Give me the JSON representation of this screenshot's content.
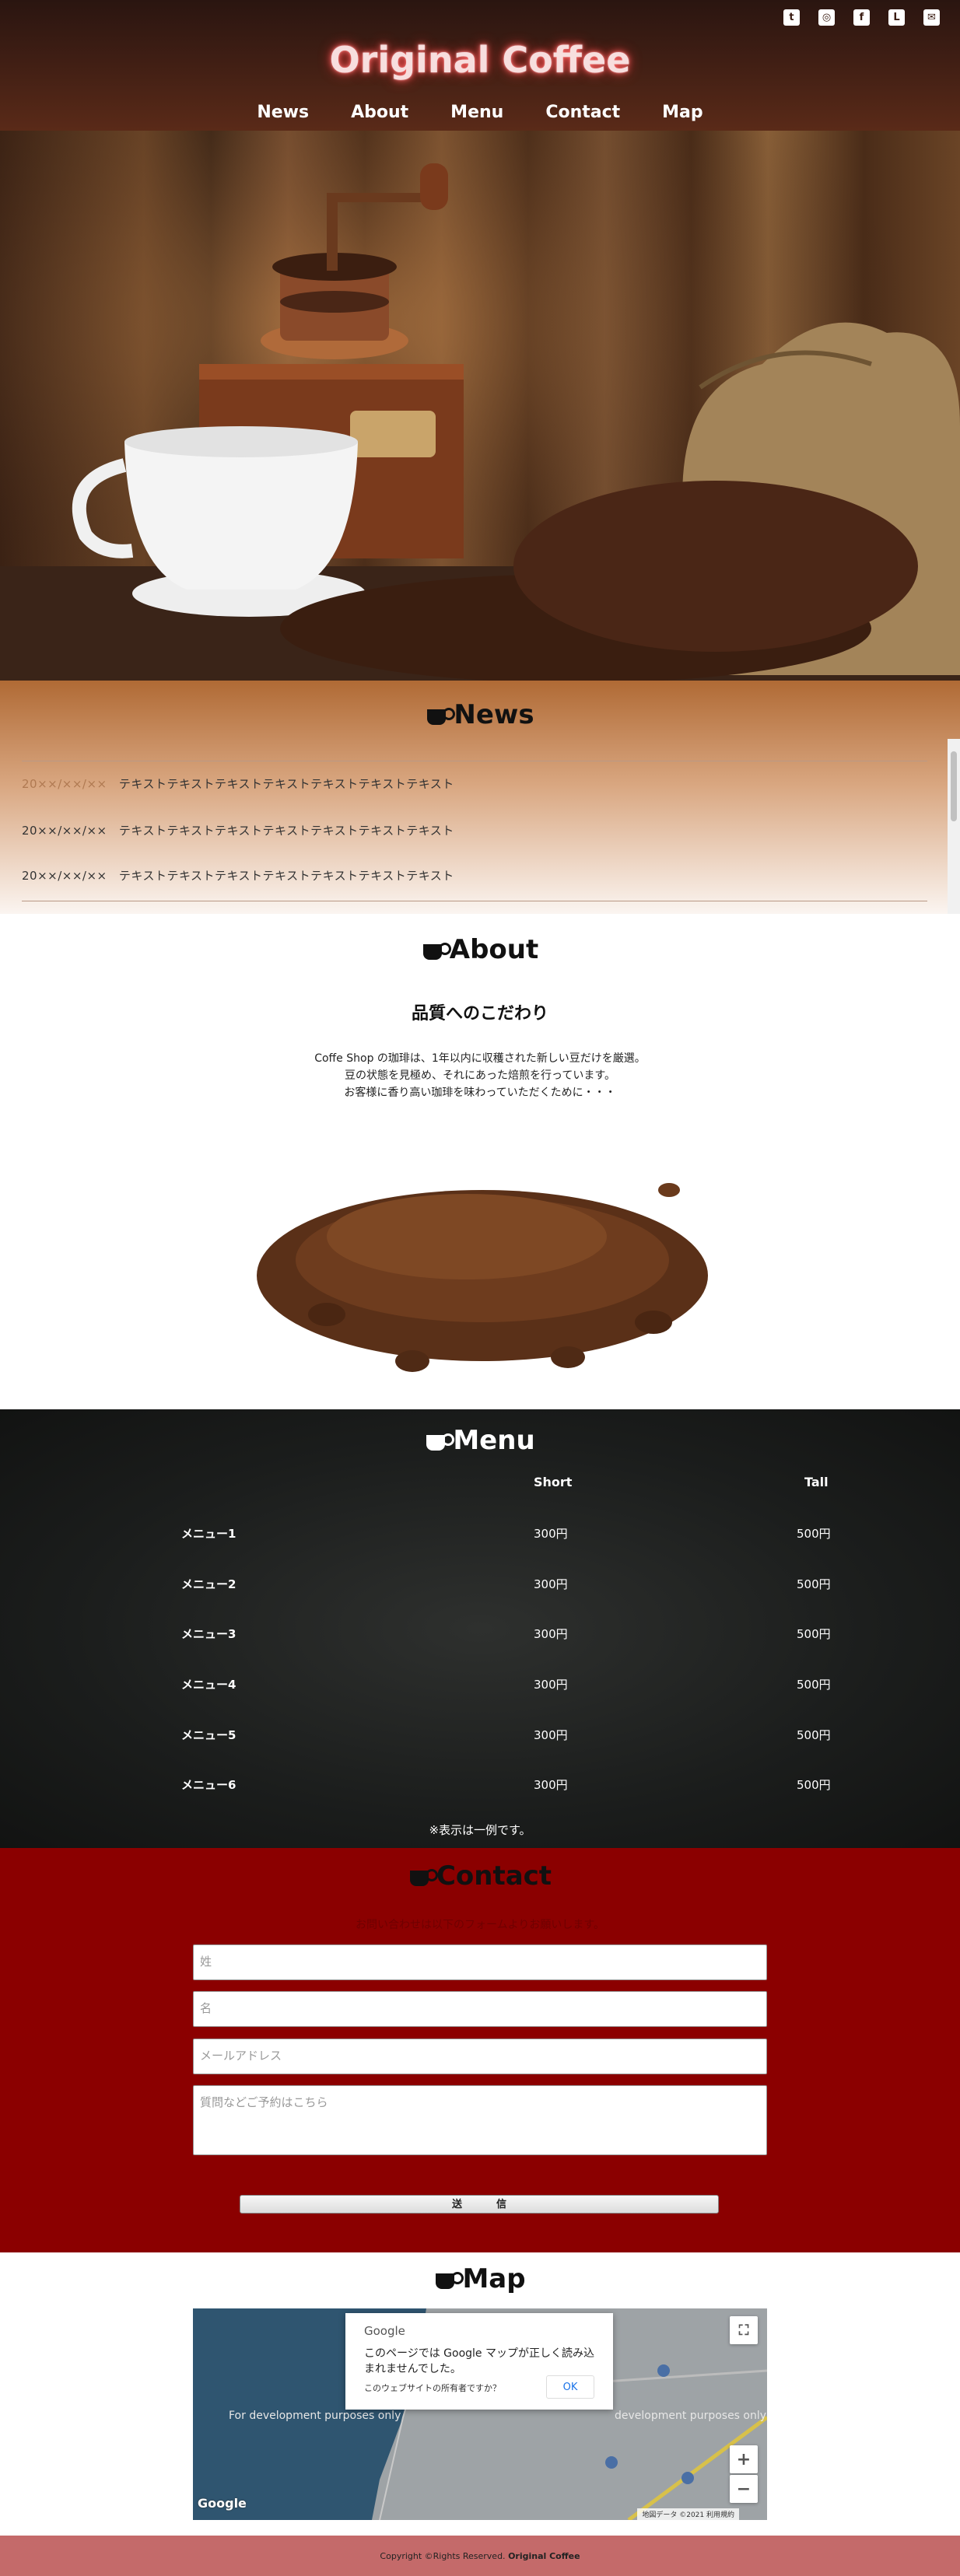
{
  "header": {
    "site_title": "Original Coffee",
    "social": [
      {
        "icon": "twitter-icon",
        "glyph": "t"
      },
      {
        "icon": "instagram-icon",
        "glyph": "◎"
      },
      {
        "icon": "facebook-icon",
        "glyph": "f"
      },
      {
        "icon": "line-icon",
        "glyph": "L"
      },
      {
        "icon": "mail-icon",
        "glyph": "✉"
      }
    ],
    "nav": [
      "News",
      "About",
      "Menu",
      "Contact",
      "Map"
    ]
  },
  "news": {
    "title": "News",
    "items": [
      {
        "date": "20××/××/××",
        "text": "テキストテキストテキストテキストテキストテキストテキスト"
      },
      {
        "date": "20××/××/××",
        "text": "テキストテキストテキストテキストテキストテキストテキスト"
      },
      {
        "date": "20××/××/××",
        "text": "テキストテキストテキストテキストテキストテキストテキスト"
      }
    ]
  },
  "about": {
    "title": "About",
    "subtitle": "品質へのこだわり",
    "lines": [
      "Coffe Shop の珈琲は、1年以内に収穫された新しい豆だけを厳選。",
      "豆の状態を見極め、それにあった焙煎を行っています。",
      "お客様に香り高い珈琲を味わっていただくために・・・"
    ]
  },
  "menu": {
    "title": "Menu",
    "columns": [
      "Short",
      "Tall"
    ],
    "rows": [
      {
        "name": "メニュー1",
        "short": "300円",
        "tall": "500円"
      },
      {
        "name": "メニュー2",
        "short": "300円",
        "tall": "500円"
      },
      {
        "name": "メニュー3",
        "short": "300円",
        "tall": "500円"
      },
      {
        "name": "メニュー4",
        "short": "300円",
        "tall": "500円"
      },
      {
        "name": "メニュー5",
        "short": "300円",
        "tall": "500円"
      },
      {
        "name": "メニュー6",
        "short": "300円",
        "tall": "500円"
      }
    ],
    "note": "※表示は一例です。"
  },
  "contact": {
    "title": "Contact",
    "lead": "お問い合わせは以下のフォームよりお願いします。",
    "fields": {
      "last_name": "姓",
      "first_name": "名",
      "email": "メールアドレス",
      "message": "質問などご予約はこちら"
    },
    "submit": "送信"
  },
  "map": {
    "title": "Map",
    "dialog_brand": "Google",
    "dialog_message": "このページでは Google マップが正しく読み込まれませんでした。",
    "dialog_owner": "このウェブサイトの所有者ですか？",
    "dialog_ok": "OK",
    "dev_text": "For development purposes only",
    "dev_text_right": "development purposes only",
    "google_logo": "Google",
    "map_footer": "地図データ ©2021  利用規約",
    "zoom_in": "+",
    "zoom_out": "−",
    "fullscreen": "⛶"
  },
  "footer": {
    "copyright_prefix": "Copyright ©Rights Reserved.",
    "copyright_brand": "Original Coffee"
  },
  "colors": {
    "header_bg": "#3f1e14",
    "contact_bg": "#8b0000",
    "footer_bg": "#c46a6a",
    "menu_bg": "#1b1d1c"
  }
}
